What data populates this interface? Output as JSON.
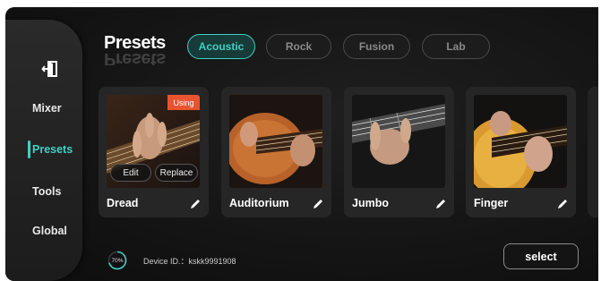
{
  "sidebar": {
    "exit_icon": "exit-door-icon",
    "items": [
      {
        "label": "Mixer"
      },
      {
        "label": "Presets"
      },
      {
        "label": "Tools"
      },
      {
        "label": "Global"
      }
    ]
  },
  "header": {
    "title": "Presets",
    "tabs": [
      {
        "label": "Acoustic"
      },
      {
        "label": "Rock"
      },
      {
        "label": "Fusion"
      },
      {
        "label": "Lab"
      }
    ]
  },
  "cards": [
    {
      "name": "Dread",
      "badge": "Using",
      "edit_label": "Edit",
      "replace_label": "Replace"
    },
    {
      "name": "Auditorium"
    },
    {
      "name": "Jumbo"
    },
    {
      "name": "Finger"
    }
  ],
  "footer": {
    "progress_label": "70%",
    "progress_value": 0.7,
    "device_id": "Device ID.：kskk9991908",
    "select_label": "select"
  },
  "colors": {
    "accent": "#3fd0c4",
    "badge": "#e8542f"
  }
}
